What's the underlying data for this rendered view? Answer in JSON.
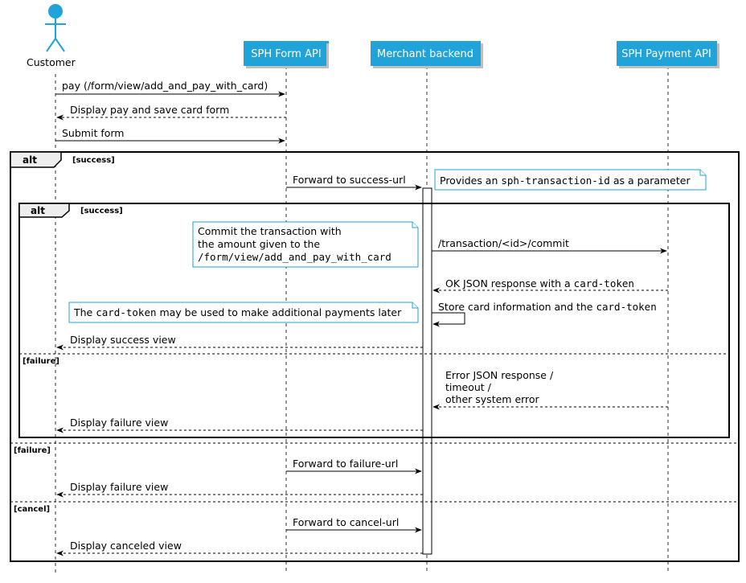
{
  "participants": {
    "customer": "Customer",
    "form_api": "SPH Form API",
    "merchant": "Merchant backend",
    "payment_api": "SPH Payment API"
  },
  "messages": {
    "m1": "pay (/form/view/add_and_pay_with_card)",
    "m2": "Display pay and save card form",
    "m3": "Submit form",
    "m4": "Forward to success-url",
    "m5": "/transaction/<id>/commit",
    "m6_pre": "OK JSON response with a ",
    "m6_code": "card-token",
    "m7_pre": "Store card information and the ",
    "m7_code": "card-token",
    "m8": "Display success view",
    "m9_l1": "Error JSON response /",
    "m9_l2": "timeout /",
    "m9_l3": "other system error",
    "m10": "Display failure view",
    "m11": "Forward to failure-url",
    "m12": "Display failure view",
    "m13": "Forward to cancel-url",
    "m14": "Display canceled view"
  },
  "notes": {
    "n1_pre": "Provides an ",
    "n1_code": "sph-transaction-id",
    "n1_post": " as a parameter",
    "n2_l1": "Commit the transaction with",
    "n2_l2": "the amount given to the",
    "n2_l3": "/form/view/add_and_pay_with_card",
    "n3_pre": "The ",
    "n3_code": "card-token",
    "n3_post": " may be used to make additional payments later"
  },
  "fragments": {
    "outer_kw": "alt",
    "outer_cond": "[success]",
    "inner_kw": "alt",
    "inner_cond": "[success]",
    "inner_failure": "[failure]",
    "outer_failure": "[failure]",
    "outer_cancel": "[cancel]"
  },
  "colors": {
    "participant_fill": "#1fa3d8",
    "note_border": "#1fa3d8",
    "actor": "#1fa3d8"
  }
}
